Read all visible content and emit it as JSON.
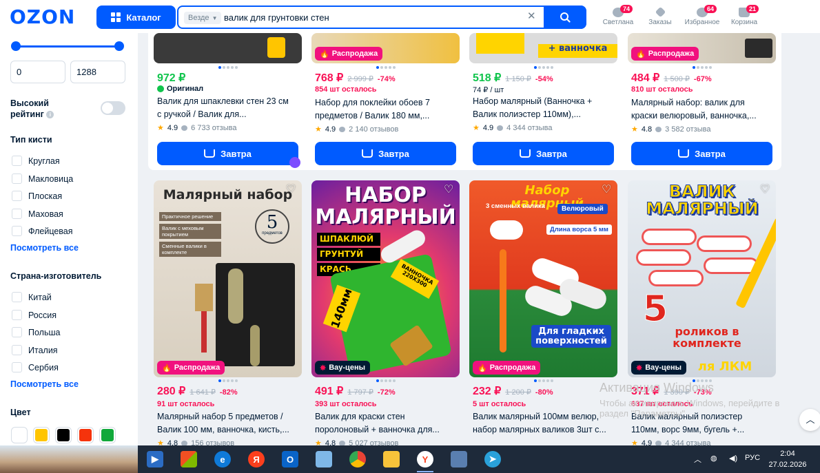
{
  "header": {
    "logo": "OZON",
    "catalog_label": "Каталог",
    "search_scope": "Везде",
    "search_value": "валик для грунтовки стен",
    "account_label": "Светлана",
    "account_badge": "74",
    "orders_label": "Заказы",
    "favorites_label": "Избранное",
    "favorites_badge": "64",
    "cart_label": "Корзина",
    "cart_badge": "21"
  },
  "sidebar": {
    "price_from": "0",
    "price_to": "1288",
    "high_rating_label_1": "Высокий",
    "high_rating_label_2": "рейтинг",
    "brush_type_title": "Тип кисти",
    "brush_types": [
      "Круглая",
      "Макловица",
      "Плоская",
      "Маховая",
      "Флейцевая"
    ],
    "see_all_1": "Посмотреть все",
    "country_title": "Страна-изготовитель",
    "countries": [
      "Китай",
      "Россия",
      "Польша",
      "Италия",
      "Сербия"
    ],
    "see_all_2": "Посмотреть все",
    "color_title": "Цвет",
    "colors": [
      "#ffffff",
      "#ffc500",
      "#000000",
      "#f5330c",
      "#10a83a"
    ]
  },
  "top_row": [
    {
      "price": "972 ₽",
      "badge": "Оригинал",
      "title1": "Валик для шпаклевки стен 23 см",
      "title2": "с ручкой / Валик для...",
      "rating": "4.9",
      "reviews": "6 733 отзыва",
      "buy": "Завтра"
    },
    {
      "price": "768 ₽",
      "old": "2 999 ₽",
      "discount": "-74%",
      "stock": "854 шт осталось",
      "sale": "Распродажа",
      "title1": "Набор для поклейки обоев 7",
      "title2": "предметов / Валик 180 мм,...",
      "rating": "4.9",
      "reviews": "2 140 отзывов",
      "buy": "Завтра"
    },
    {
      "price": "518 ₽",
      "old": "1 150 ₽",
      "discount": "-54%",
      "unit": "74 ₽ / шт",
      "promo": "+ ванночка",
      "title1": "Набор малярный (Ванночка +",
      "title2": "Валик полиэстер 110мм),...",
      "rating": "4.9",
      "reviews": "4 344 отзыва",
      "buy": "Завтра"
    },
    {
      "price": "484 ₽",
      "old": "1 500 ₽",
      "discount": "-67%",
      "stock": "810 шт осталось",
      "sale": "Распродажа",
      "title1": "Малярный набор: валик для",
      "title2": "краски велюровый, ванночка,...",
      "rating": "4.8",
      "reviews": "3 582 отзыва",
      "buy": "Завтра"
    }
  ],
  "bottom_row": [
    {
      "promo_title": "Малярный набор",
      "promo_tags": [
        "Практичное решение",
        "Валик с меховым покрытием",
        "Сменные валики в комплекте"
      ],
      "promo_num": "5",
      "promo_num_sub": "предметов",
      "sale": "Распродажа",
      "price": "280 ₽",
      "old": "1 641 ₽",
      "discount": "-82%",
      "stock": "91 шт осталось",
      "title1": "Малярный набор 5 предметов /",
      "title2": "Валик 100 мм, ванночка, кисть,...",
      "rating": "4.8",
      "reviews": "156 отзывов"
    },
    {
      "promo_title": "НАБОР МАЛЯРНЫЙ",
      "promo_tags": [
        "ШПАКЛЮЙ",
        "ГРУНТУЙ",
        "КРАСЬ"
      ],
      "promo_size": "140мм",
      "promo_tray": "ВАННОЧКА 220Х300",
      "sale": "Вау-цены",
      "price": "491 ₽",
      "old": "1 797 ₽",
      "discount": "-72%",
      "stock": "393 шт осталось",
      "title1": "Валик для краски стен",
      "title2": "поролоновый + ванночка для...",
      "rating": "4.8",
      "reviews": "5 027 отзывов"
    },
    {
      "promo_title": "Набор малярный",
      "promo_sub": "3 сменных валика",
      "promo_tag": "Велюровый",
      "promo_len": "Длина ворса 5 мм",
      "promo_bottom": "Для гладких поверхностей",
      "sale": "Распродажа",
      "price": "232 ₽",
      "old": "1 200 ₽",
      "discount": "-80%",
      "stock": "5 шт осталось",
      "title1": "Валик малярный 100мм велюр,",
      "title2": "набор малярных валиков 3шт с...",
      "rating": "",
      "reviews": ""
    },
    {
      "promo_title": "ВАЛИК МАЛЯРНЫЙ",
      "promo_num": "5",
      "promo_bottom": "роликов в комплекте",
      "promo_lkm": "ля ЛКМ",
      "sale": "Вау-цены",
      "price": "371 ₽",
      "old": "1 390 ₽",
      "discount": "-73%",
      "stock": "637 шт осталось",
      "title1": "Валик малярный полиэстер",
      "title2": "110мм, ворс 9мм, бугель +...",
      "rating": "4.9",
      "reviews": "4 344 отзыва"
    }
  ],
  "windows": {
    "activation_1": "Активация Windows",
    "activation_2": "Чтобы активировать Windows, перейдите в",
    "activation_3": "раздел \"Параметры\".",
    "lang": "РУС",
    "time": "2:04",
    "date": "27.02.2026"
  }
}
